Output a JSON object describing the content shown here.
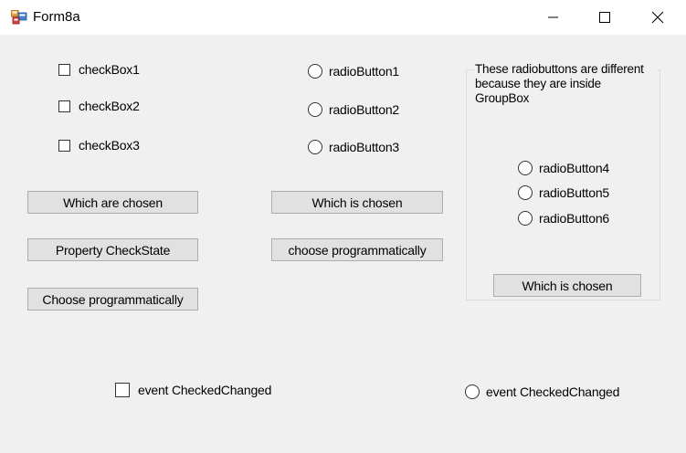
{
  "window": {
    "title": "Form8a",
    "icons": {
      "app": "winforms-app-icon",
      "minimize": "minimize-icon",
      "maximize": "maximize-icon",
      "close": "close-icon"
    }
  },
  "checkboxes": [
    {
      "label": "checkBox1",
      "checked": false
    },
    {
      "label": "checkBox2",
      "checked": false
    },
    {
      "label": "checkBox3",
      "checked": false
    }
  ],
  "radiobuttons": [
    {
      "label": "radioButton1",
      "checked": false
    },
    {
      "label": "radioButton2",
      "checked": false
    },
    {
      "label": "radioButton3",
      "checked": false
    }
  ],
  "buttons": {
    "which_are_chosen": "Which are chosen",
    "property_checkstate": "Property CheckState",
    "choose_programmatically_cb": "Choose programmatically",
    "which_is_chosen": "Which is chosen",
    "choose_programmatically_rb": "choose programmatically"
  },
  "groupbox": {
    "caption": "These radiobuttons are different because they are inside GroupBox",
    "radiobuttons": [
      {
        "label": "radioButton4",
        "checked": false
      },
      {
        "label": "radioButton5",
        "checked": false
      },
      {
        "label": "radioButton6",
        "checked": false
      }
    ],
    "button_label": "Which is chosen"
  },
  "events": {
    "checkbox_event_label": "event CheckedChanged",
    "radio_event_label": "event CheckedChanged"
  }
}
